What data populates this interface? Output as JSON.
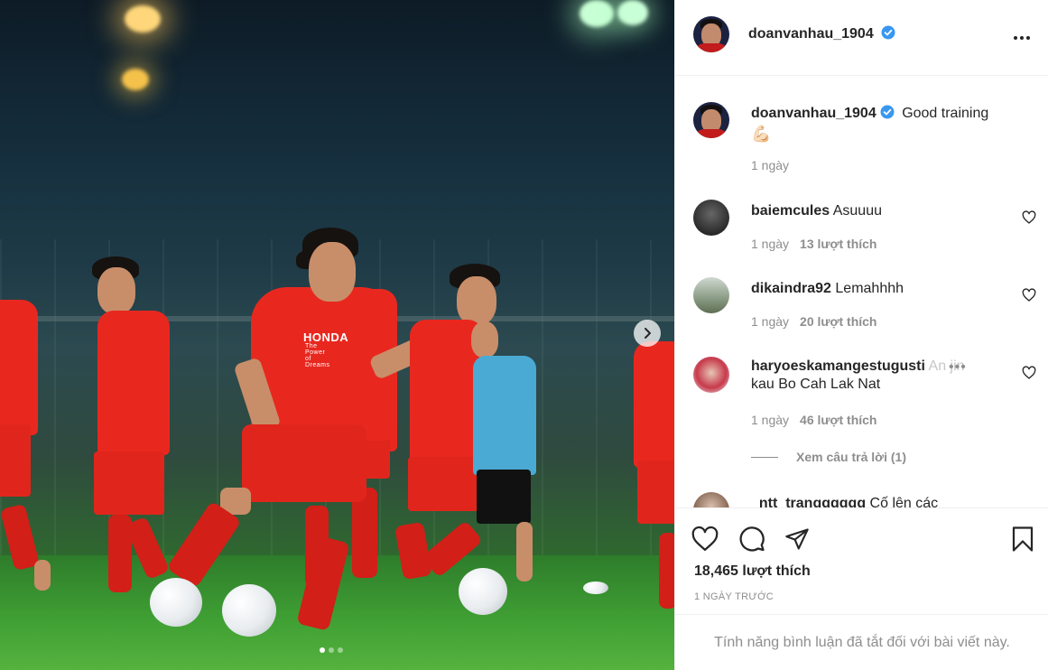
{
  "post": {
    "author": "doanvanhau_1904",
    "caption": "Good training",
    "caption_emoji": "💪🏻",
    "caption_time": "1 ngày",
    "likes_text": "18,465 lượt thích",
    "date_text": "1 NGÀY TRƯỚC",
    "comments_disabled_text": "Tính năng bình luận đã tắt đối với bài viết này."
  },
  "photo": {
    "shirt_sponsor": "HONDA",
    "shirt_tagline": "The Power of Dreams",
    "carousel_count": 3,
    "carousel_active": 0
  },
  "comments": [
    {
      "user": "baiemcules",
      "text": "Asuuuu",
      "time": "1 ngày",
      "likes": "13 lượt thích"
    },
    {
      "user": "dikaindra92",
      "text": "Lemahhhh",
      "time": "1 ngày",
      "likes": "20 lượt thích"
    },
    {
      "user": "haryoeskamangestugusti",
      "text_tail": "An jin",
      "text_line2": "kau Bo Cah Lak Nat",
      "time": "1 ngày",
      "likes": "46 lượt thích",
      "replies": "Xem câu trả lời (1)"
    },
    {
      "user": "_ntt_trangggggg",
      "text": "Cố lên các"
    }
  ],
  "icons": {
    "more": "more-horizontal-icon",
    "verified": "verified-badge-icon",
    "like": "heart-icon",
    "comment": "comment-icon",
    "share": "share-icon",
    "save": "bookmark-icon",
    "next": "chevron-right-icon"
  },
  "colors": {
    "verified": "#3897f0",
    "text": "#262626",
    "muted": "#8e8e8e",
    "divider": "#efefef",
    "jersey": "#e8281f"
  }
}
